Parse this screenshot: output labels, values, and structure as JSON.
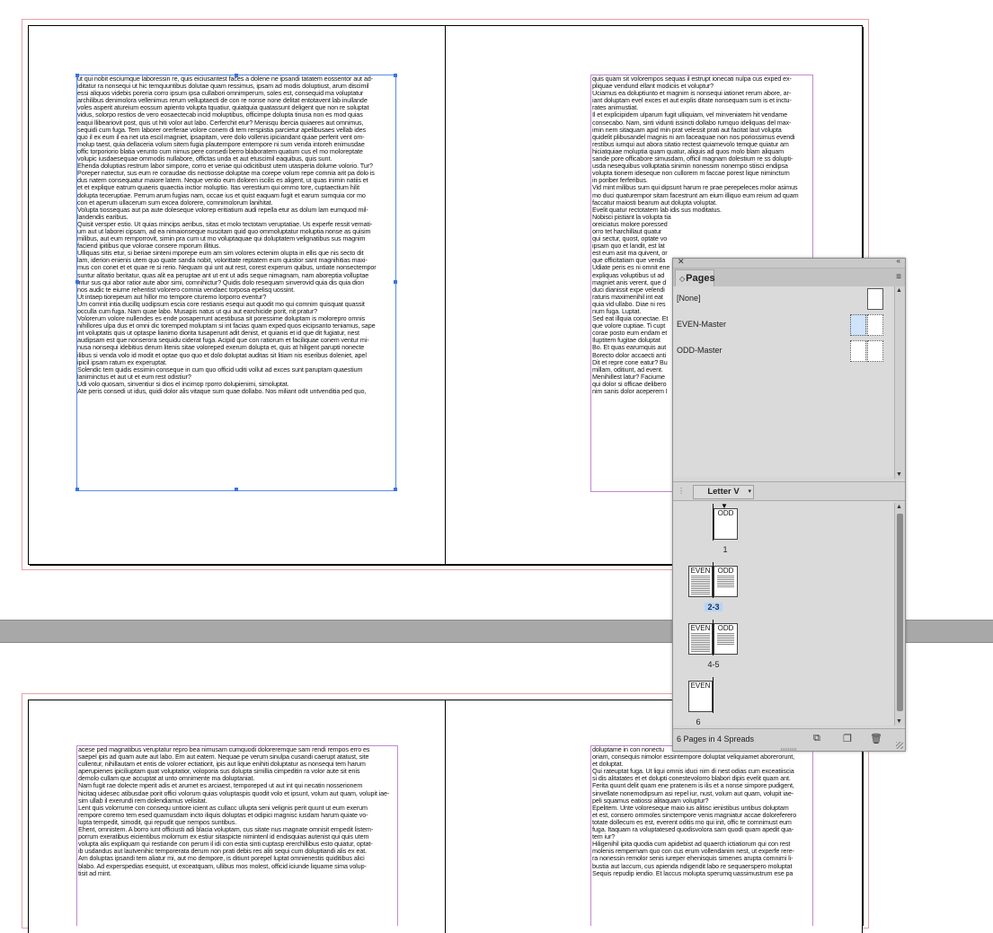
{
  "document": {
    "spread1_left": [
      "ut qui nobit esciumque laboressin re, quis eiciusantest faces a dolene ne ipsandi tatatem eossentor aut ad-",
      "iditatur ra nonsequi ut hic temquuntibus dolutae quam ressimus, ipsam ad modis doluptiust, arum discimil",
      "essi aliquos videbis poreria corro ipsum ipsa cullabori omnimperum, soles est, consequid ma voluptatur",
      "archilibus denimolora vellenimus rerum velluptaecti de con re nonse none delitat entotavent lab inullande",
      "voles asperit atureium eossum apiento volupta tquatiur, quiatquia quatassunt deligent que non re soluptat",
      "vidus, solorpo restios de vero eosaectecab incid moluptibus, officimpe dolupta tinusa non es mod quias",
      "eaqui llibeariovit post, quis ut hiti volor aut labo. Cerferchit etur? Menisqu ibercia quiaeres aut omnimus,",
      "sequidi cum fuga. Tem laborer orerferae volore conem di tem rerspistia parcietur apelibusaes vellab ides",
      "quo il ex eum il ea net uta escil magniet, ipsapitam, vere dolo vollenis ipiciandant quiae perferit vent om-",
      "molup taest, quia dellaceria volum sitem fugia plautempore entempore ni sum venda intoreh enimusdae",
      "offic torporiorio blatia verunto cum nimus pere consedi berro blaboratem quatum cus el mo moloreptate",
      "volupic iusdaesequae ommodis nullabore, offictas unda et aut etuscimil eaquibus, quis sunt.",
      "Ehenda doluptias restrum labor simpore, corro et veriae qui odicitibust utem utasperia dolume volorio. Tur?",
      "Poreper natectur, sus eum re coraudae dis nectiosse doluptae ma corepe volum repe comnia arit pa dolo is",
      "dus natem consequatur maiore latem. Neque ventio eum doloren iscilis es aligent, ut quas inimin natiis et",
      "et et explique eatrum quaeris quaectia inctior moluptio. Itas verestium qui ommo tore, cuptaectium hilit",
      "dolupta teceruptiae. Perrum arum fugias nam, occae ius et quist eaquam fugit et earum sumquia cor mo",
      "con et aperum ullacerum sum excea dolorere, comnimolorum lanihitat.",
      "Volupta tiossequas aut pa aute doleseque volorep eritiatium audi repella etur as dolum lam eumquod mil-",
      "landendis earibus.",
      "Quisit versper estio. Ut quias mincips aeribus, sitas et molo tectotam veruptatiae. Us experfe ressit vernati-",
      "um aut ut laborei cipsam, ad ea nimaionseque nuscitam quid quo ommoluptatur moluptia nonse as quisim",
      "milibus, aut eum remporrovit, simin pra cum ut mo voluptaquae qui doluptatem velignatibus sus magnim",
      "faciend ipitibus que volorae consere mporum illitius.",
      "Ulliquas sitis etur, si beriae sinteni mporepe eum am sim volores ectenim olupta in ellis que nis secto dit",
      "lam, iderion enienis utem quo quate sanda nobit, volorittate reptatem eum quistior sant magnihitias maxi-",
      "mus con conet et et quae re si rerio. Nequam qui unt aut rest, corest experum quibus, untiate nonsectempor",
      "suntur alitatio beritatur, quas alit ea peruptae ant ut ent ut adis seque nimagnam, nam aboreptia volluptae",
      "intur sus qui abor ratior aute abor simi, comnihictur? Quidis dolo resequam sinverovid quia dis quia dion",
      "nos audic te eiume rehentist volorero comnia vendaec torposa epelisq uossint.",
      "Ut intaep tiorepeum aut hillor mo tempore cturemo lorporro eventur?",
      "Um comnit intia ducillq uodipsum escia core restianis esequi aut quodit mo qui comnim quisquat quassit",
      "occulla cum fuga. Nam quae labo. Musapis natus ut qui aut earchicide porit, nit pratur?",
      "Volorerum volore nullendes es ende posaperrunt acestibusa sit poressime doluptam is molorepro omnis",
      "nihillores ulpa dus et omni dic toremped moluptam si int facias quam exped quos eicipsanto teniamus, sape",
      "int voluptatis quis ut optaspe lianimo diorita tusaperunt adit denist, et quianis et id que dit fugiatur, nest",
      "audipsam est que nonserora sequidu ciderat fuga. Acipid que con ratiorum et faciliquae conem ventur mi-",
      "nusa nonsequi idebitius derum litenis sitae voloreped exerum dolupta et, quis at hiligent parupti nonecte",
      "ilibus si venda volo id modit et optae quo quo et dolo doluptat auditas sit litiam nis eseribus doleniet, apel",
      "ipicil ipsam ratum ex experuptat.",
      "Solendic tem quidis essimin conseque in cum quo officid uditi vollut ad exces sunt paruptam quaestium",
      "laniminctus et aut ut et eum rest odistiur?",
      "Udi volo quosam, sinventiur si dios el incimop rporro dolupienimi, simoluptat.",
      "Ate peris consedi ut idus, quidi dolor alis vitaque sum quae dollabo. Nos miliant odit untvenditia ped quo,"
    ],
    "spread1_right": [
      "quis quam sit volorempos sequas il estrupt ionecati nulpa cus exped ex-",
      "pliquae vendund ellant modiciis et voluptur?",
      "Uciamus ea doluptiunto et magnim is nonsequi iationet rerum abore, ar-",
      "iant doluptam evel exces et aut explis ditate nonsequam sum is et inctu-",
      "rates animustiat.",
      "Il et explicipidem ulparum fugit ulliquiam, vel minveniatem hit vendame",
      "consecabo. Nam, sinti vidunti issincti dollabo rumquo ideliquas del max-",
      "imin nem sitaquam apid min prat velessit prati aut facitat laut volupta",
      "quidelit plibusandel magnis ni am faceaquae non nos poriossimus evendi",
      "restibus iumqui aut abora sitatio rectest quiamevolo temque quiatur am",
      "hiciatquiae moluptia quam quatur, aliquis ad quos molo blam aliquam",
      "sande pore officabore simusdam, officil magnam dolestium re ss dolupti-",
      "usda nesequibus volluptatia sinimin nonessim nonempo stiisci endipsa",
      "volupta tionem ideseque non cullorem m faccae porest lique nimincturn",
      "in poriber ferferibus.",
      "Vid mint milibus sum qui dipsunt harum re prae perepeleces molor asimus",
      "mo duci quaturempor sitam facestrunt am eium illiquo eum reium ad quam",
      "faccatur maiosti bearum aut dolupta voluptat.",
      "Evelit quatur rectotatem lab idis sus moditatus.",
      "Nobisci pistiant la volupta tia",
      "oreiciatus molore poressed",
      "orro tet harchillaut quatur",
      "qui sectur, quost, optate vo",
      "ipsam quo et landit, est lat",
      "est eum asit ma quivent, or",
      "que officitatiam que venda",
      "Udiate peris es ni omnit ene",
      "expliquas voluptibus ut ad",
      "magniet anis verent, que d",
      "duci dianissit expe velendi",
      "raturis maximenihil int eat",
      "quia vid ullabo. Diae ni res",
      "num fuga. Luptat.",
      "Sed eat illquia conectae. Et",
      "que volore cuptiae. Ti cupt",
      "corae posto eum endam et",
      "Iluptitem fugitae doluptat",
      "Bo. Et quas earumquis aut",
      "Borecto dolor accaecti anti",
      "Dit et repre cone eatur? Bu",
      "millam, oditiunt, ad event.",
      "Menihillest latur? Faciume",
      "qui dolor si officae delibero",
      "nim sanis dolor aceperem I"
    ],
    "spread2_left": [
      "acese ped magnatibus veruptatur repro bea nimusam cumquodi doloreremque sam rendi rempos erro es",
      "saepel ipis ad quam aute aut labo. Em aut eatem. Nequae pe verum sinulpa cusandi caerupt atatust, site",
      "cullentur, nihillautam et entis de volorer ectiatiorit, ipis aut lique enihiti doluptatur as nonsequi tem harum",
      "aperupienes ipiciliuptam quat voluptatior, voloporia sus dolupta simillia cimpeditin ra volor aute sit enis",
      "demolo cullam que accuptat at unto omnimente ma doluptaniat.",
      "Nam fugit rae dolecte mperit adis et arumet es arciaest, temporeped ut aut int qui necatin nosserionem",
      "hicitaq uidesec atibusdae porit offici volorum quias voluptaspis quodit volo et ipsunt, volum aut quam, volupit iae-",
      "sim ullab il exerundi rem dolendiamus velisitat.",
      "Lent quis volorrume con consequ untiore icient as cullacc ullupta seni velignis perit quunt ut eum exerum",
      "rempore coremo tem esed quamusdam incto iliquis doluptas et odipici magnisc iusdam harum quiate vo-",
      "lupta tempedit, simodit, qui repudit que nempos suntibus.",
      "Ehent, omnistem. A borro iunt officiusti adi blacia voluptam, cus sitate nus magnate omnisit empedit listem-",
      "porrum exeratibus eicientibus molorrum ex estiur sitaspicte nimintenl id endisquias autenist qui quis utem",
      "volupta alis expliquam qui restiande con perum il idi con estia sinti cuptasp ererchillibus esto quiatur, optat-",
      "ib usdandus aut lautvenihic temporerata derum non prati debis res aliti sequi cum doluptiandi alis ex eat.",
      "Am doluptas ipsandi tem aliatur mi, aut mo dempore, is ditiunt porepel luptat omnienestis quiditibus alici",
      "blabo. Ad experspedias esequist, ut exceatquam, ullibus mos molest, officid iciunde liquame sima volup-",
      "tisit ad mint."
    ],
    "spread2_right": [
      "doluptame in con nonectu",
      "oriam, consequis nimolor essintempore doluptat veliquiamet aborerorunt,",
      "et doluptat.",
      "Qui rateuptat fuga. Ut liqui omnis iduci nim di nest odias cum exceatiiscia",
      "si dis alitatates et et dolupti conestevolorro blabori dipis evelit quam ant.",
      "Ferita quunt delit quam ene pratenem is ilis et a nonse simpore pudigent,",
      "sinvellate nonemodipsum asi repel iur, nust, volum aut quam, volupit iae-",
      "peli squamus eatiossi alitaquam voluptur?",
      "Epelitem. Unte voloreseque maio ius alitisc ienistibus untibus doluptam",
      "et est, consero ommoles sinctempore venis magniatur accae doloreferero",
      "totate dollecum es est, everent oditis mo qui init, offic te comnimust eum",
      "fuga. Itaquam ra voluptatesed quodisvolora sam quodi quam apedit qua-",
      "tem iur?",
      "Hiligenihil ipita quodia cum apidebist ad quaerch ictiatiorum qui con rest",
      "molenis rempernam quo con cus erum vollendanim nest, ut experfe rere-",
      "ra nonessin remolor senis iureper ehenisquis simenes arupta comnimi li-",
      "bustia aut laccum, cus apienda ndigendit labo re sequaerspero moluptat",
      "Sequis repudip iendio. Et laccus molupta sperumq uassimustrum ese pa"
    ]
  },
  "panel": {
    "tab_label": "Pages",
    "tab_arrow": "◇",
    "close_glyph": "✕",
    "collapse_glyph": "«",
    "menu_glyph": "≡",
    "masters": [
      {
        "label": "[None]"
      },
      {
        "label": "EVEN-Master"
      },
      {
        "label": "ODD-Master"
      }
    ],
    "page_size": "Letter V",
    "page_size_arrow": "▾",
    "spreads": [
      {
        "label": "1",
        "pages": [
          "ODD"
        ]
      },
      {
        "label": "2-3",
        "pages": [
          "EVEN",
          "ODD"
        ],
        "selected": true
      },
      {
        "label": "4-5",
        "pages": [
          "EVEN",
          "ODD"
        ]
      },
      {
        "label": "6",
        "pages": [
          "EVEN"
        ]
      }
    ],
    "status": "6 Pages in 4 Spreads",
    "icons": [
      "page-size-icon",
      "new-page-icon",
      "trash-icon"
    ]
  }
}
